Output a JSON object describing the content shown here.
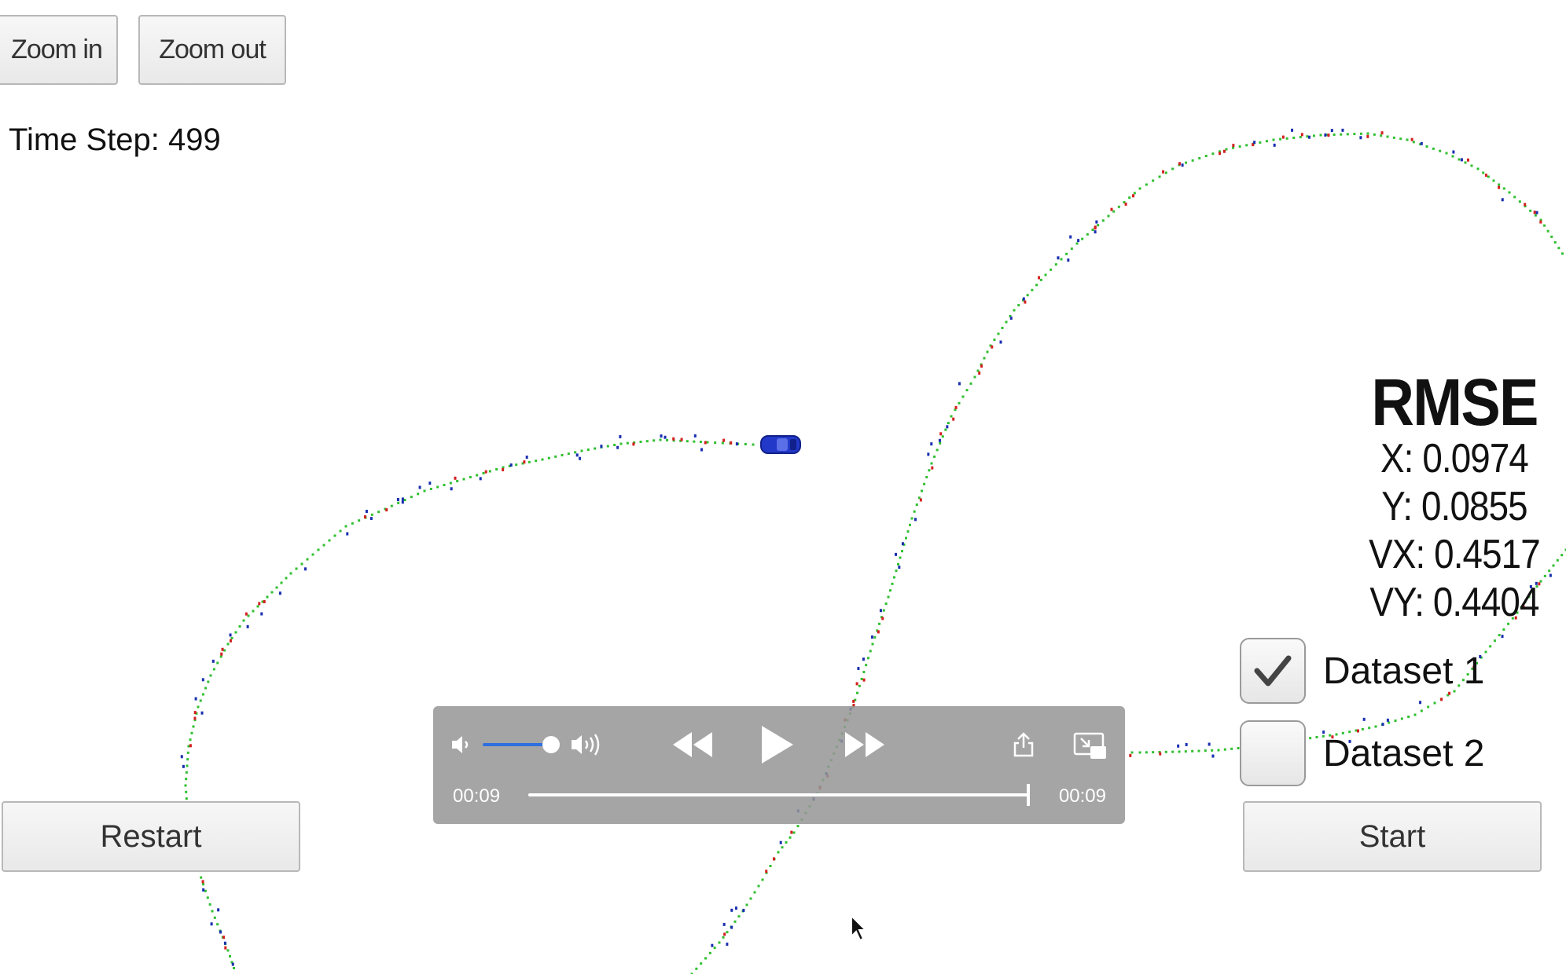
{
  "toolbar": {
    "zoom_in_label": "Zoom in",
    "zoom_out_label": "Zoom out"
  },
  "status": {
    "time_step_text": "Time Step: 499"
  },
  "rmse": {
    "title": "RMSE",
    "x": "X: 0.0974",
    "y": "Y: 0.0855",
    "vx": "VX: 0.4517",
    "vy": "VY: 0.4404"
  },
  "datasets": [
    {
      "label": "Dataset 1",
      "checked": true
    },
    {
      "label": "Dataset 2",
      "checked": false
    }
  ],
  "buttons": {
    "restart_label": "Restart",
    "start_label": "Start"
  },
  "player": {
    "current_time": "00:09",
    "total_time": "00:09",
    "volume_fraction": 0.95,
    "progress_fraction": 1.0,
    "icons": [
      "volume-low-icon",
      "volume-high-icon",
      "rewind-icon",
      "play-icon",
      "fast-forward-icon",
      "share-icon",
      "picture-in-picture-icon"
    ]
  },
  "colors": {
    "track": "#2fbf2f",
    "lidar": "#d42020",
    "radar": "#1a2fb0",
    "car": "#2238c8",
    "player_progress": "#ffffff",
    "volume_fill": "#2f6fe0"
  }
}
